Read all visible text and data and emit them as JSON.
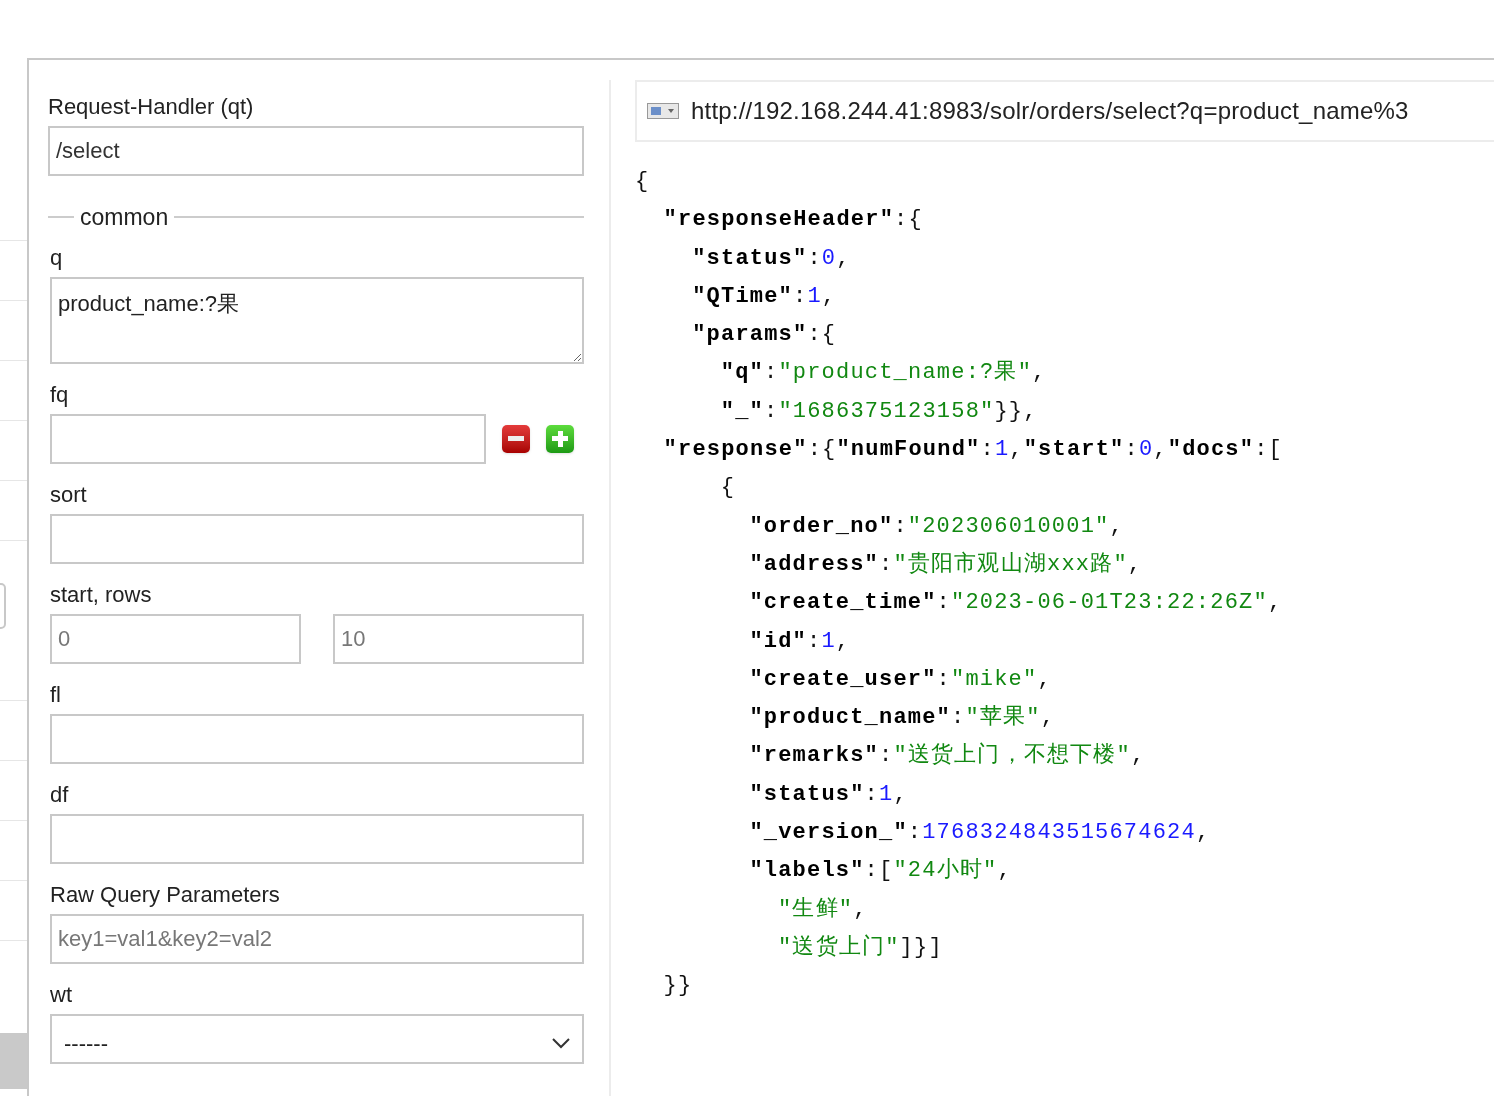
{
  "form": {
    "handler": {
      "label": "Request-Handler (qt)",
      "value": "/select"
    },
    "section_legend": "common",
    "fields": [
      {
        "kind": "textarea",
        "label": "q",
        "value": "product_name:?果"
      },
      {
        "kind": "filter",
        "label": "fq"
      },
      {
        "kind": "text",
        "label": "sort"
      },
      {
        "kind": "pair",
        "label": "start, rows",
        "placeholders": [
          "0",
          "10"
        ]
      },
      {
        "kind": "text",
        "label": "fl"
      },
      {
        "kind": "text",
        "label": "df"
      },
      {
        "kind": "text",
        "label": "Raw Query Parameters",
        "placeholder": "key1=val1&key2=val2"
      },
      {
        "kind": "select",
        "label": "wt",
        "value": "------"
      }
    ]
  },
  "result": {
    "url": "http://192.168.244.41:8983/solr/orders/select?q=product_name%3",
    "lines": [
      {
        "tokens": [
          {
            "kind": "punct",
            "text": "{"
          }
        ],
        "children": [
          {
            "tokens": [
              {
                "kind": "key",
                "text": "\"responseHeader\""
              },
              {
                "kind": "punct",
                "text": ":{"
              }
            ],
            "children": [
              {
                "tokens": [
                  {
                    "kind": "key",
                    "text": "\"status\""
                  },
                  {
                    "kind": "punct",
                    "text": ":"
                  },
                  {
                    "kind": "number",
                    "text": "0"
                  },
                  {
                    "kind": "punct",
                    "text": ","
                  }
                ]
              },
              {
                "tokens": [
                  {
                    "kind": "key",
                    "text": "\"QTime\""
                  },
                  {
                    "kind": "punct",
                    "text": ":"
                  },
                  {
                    "kind": "number",
                    "text": "1"
                  },
                  {
                    "kind": "punct",
                    "text": ","
                  }
                ]
              },
              {
                "tokens": [
                  {
                    "kind": "key",
                    "text": "\"params\""
                  },
                  {
                    "kind": "punct",
                    "text": ":{"
                  }
                ],
                "children": [
                  {
                    "tokens": [
                      {
                        "kind": "key",
                        "text": "\"q\""
                      },
                      {
                        "kind": "punct",
                        "text": ":"
                      },
                      {
                        "kind": "string",
                        "text": "\"product_name:?果\""
                      },
                      {
                        "kind": "punct",
                        "text": ","
                      }
                    ]
                  },
                  {
                    "tokens": [
                      {
                        "kind": "key",
                        "text": "\"_\""
                      },
                      {
                        "kind": "punct",
                        "text": ":"
                      },
                      {
                        "kind": "string",
                        "text": "\"1686375123158\""
                      },
                      {
                        "kind": "punct",
                        "text": "}},"
                      }
                    ]
                  }
                ]
              }
            ]
          },
          {
            "tokens": [
              {
                "kind": "key",
                "text": "\"response\""
              },
              {
                "kind": "punct",
                "text": ":{"
              },
              {
                "kind": "key",
                "text": "\"numFound\""
              },
              {
                "kind": "punct",
                "text": ":"
              },
              {
                "kind": "number",
                "text": "1"
              },
              {
                "kind": "punct",
                "text": ","
              },
              {
                "kind": "key",
                "text": "\"start\""
              },
              {
                "kind": "punct",
                "text": ":"
              },
              {
                "kind": "number",
                "text": "0"
              },
              {
                "kind": "punct",
                "text": ","
              },
              {
                "kind": "key",
                "text": "\"docs\""
              },
              {
                "kind": "punct",
                "text": ":["
              }
            ],
            "children": [
              {
                "children": [
                  {
                    "tokens": [
                      {
                        "kind": "punct",
                        "text": "{"
                      }
                    ],
                    "children": [
                      {
                        "tokens": [
                          {
                            "kind": "key",
                            "text": "\"order_no\""
                          },
                          {
                            "kind": "punct",
                            "text": ":"
                          },
                          {
                            "kind": "string",
                            "text": "\"202306010001\""
                          },
                          {
                            "kind": "punct",
                            "text": ","
                          }
                        ]
                      },
                      {
                        "tokens": [
                          {
                            "kind": "key",
                            "text": "\"address\""
                          },
                          {
                            "kind": "punct",
                            "text": ":"
                          },
                          {
                            "kind": "string",
                            "text": "\"贵阳市观山湖xxx路\""
                          },
                          {
                            "kind": "punct",
                            "text": ","
                          }
                        ]
                      },
                      {
                        "tokens": [
                          {
                            "kind": "key",
                            "text": "\"create_time\""
                          },
                          {
                            "kind": "punct",
                            "text": ":"
                          },
                          {
                            "kind": "string",
                            "text": "\"2023-06-01T23:22:26Z\""
                          },
                          {
                            "kind": "punct",
                            "text": ","
                          }
                        ]
                      },
                      {
                        "tokens": [
                          {
                            "kind": "key",
                            "text": "\"id\""
                          },
                          {
                            "kind": "punct",
                            "text": ":"
                          },
                          {
                            "kind": "number",
                            "text": "1"
                          },
                          {
                            "kind": "punct",
                            "text": ","
                          }
                        ]
                      },
                      {
                        "tokens": [
                          {
                            "kind": "key",
                            "text": "\"create_user\""
                          },
                          {
                            "kind": "punct",
                            "text": ":"
                          },
                          {
                            "kind": "string",
                            "text": "\"mike\""
                          },
                          {
                            "kind": "punct",
                            "text": ","
                          }
                        ]
                      },
                      {
                        "tokens": [
                          {
                            "kind": "key",
                            "text": "\"product_name\""
                          },
                          {
                            "kind": "punct",
                            "text": ":"
                          },
                          {
                            "kind": "string",
                            "text": "\"苹果\""
                          },
                          {
                            "kind": "punct",
                            "text": ","
                          }
                        ]
                      },
                      {
                        "tokens": [
                          {
                            "kind": "key",
                            "text": "\"remarks\""
                          },
                          {
                            "kind": "punct",
                            "text": ":"
                          },
                          {
                            "kind": "string",
                            "text": "\"送货上门，不想下楼\""
                          },
                          {
                            "kind": "punct",
                            "text": ","
                          }
                        ]
                      },
                      {
                        "tokens": [
                          {
                            "kind": "key",
                            "text": "\"status\""
                          },
                          {
                            "kind": "punct",
                            "text": ":"
                          },
                          {
                            "kind": "number",
                            "text": "1"
                          },
                          {
                            "kind": "punct",
                            "text": ","
                          }
                        ]
                      },
                      {
                        "tokens": [
                          {
                            "kind": "key",
                            "text": "\"_version_\""
                          },
                          {
                            "kind": "punct",
                            "text": ":"
                          },
                          {
                            "kind": "number",
                            "text": "1768324843515674624"
                          },
                          {
                            "kind": "punct",
                            "text": ","
                          }
                        ]
                      },
                      {
                        "tokens": [
                          {
                            "kind": "key",
                            "text": "\"labels\""
                          },
                          {
                            "kind": "punct",
                            "text": ":["
                          },
                          {
                            "kind": "string",
                            "text": "\"24小时\""
                          },
                          {
                            "kind": "punct",
                            "text": ","
                          }
                        ],
                        "children": [
                          {
                            "tokens": [
                              {
                                "kind": "string",
                                "text": "\"生鲜\""
                              },
                              {
                                "kind": "punct",
                                "text": ","
                              }
                            ]
                          },
                          {
                            "tokens": [
                              {
                                "kind": "string",
                                "text": "\"送货上门\""
                              },
                              {
                                "kind": "punct",
                                "text": "]}]"
                              }
                            ]
                          }
                        ]
                      }
                    ]
                  }
                ]
              }
            ]
          },
          {
            "tokens": [
              {
                "kind": "punct",
                "text": "}}"
              }
            ]
          }
        ]
      }
    ]
  }
}
